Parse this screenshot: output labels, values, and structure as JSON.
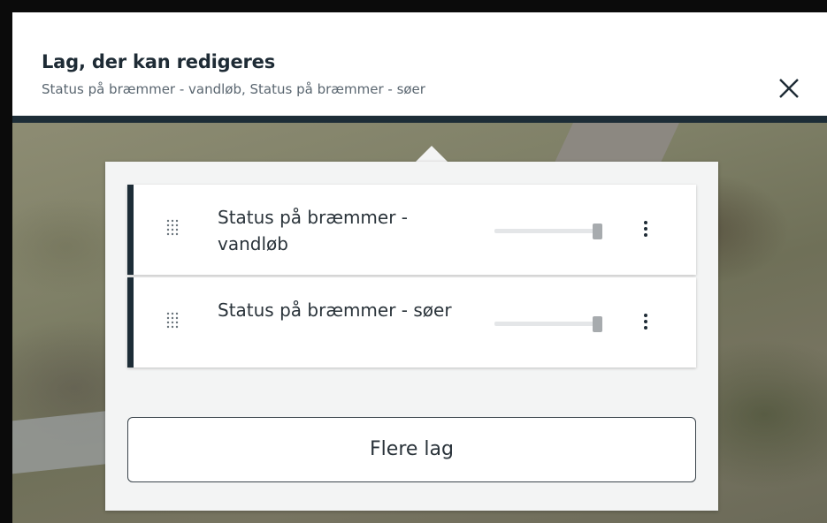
{
  "header": {
    "title": "Lag, der kan redigeres",
    "subtitle": "Status på bræmmer - vandløb, Status på bræmmer - søer",
    "close_icon": "close-icon"
  },
  "layers": [
    {
      "label": "Status på bræmmer - vandløb",
      "opacity": 1.0,
      "drag_icon": "drag-handle-icon",
      "menu_icon": "kebab-menu-icon"
    },
    {
      "label": "Status på bræmmer - søer",
      "opacity": 1.0,
      "drag_icon": "drag-handle-icon",
      "menu_icon": "kebab-menu-icon"
    }
  ],
  "footer": {
    "more_layers_label": "Flere lag"
  },
  "colors": {
    "accent": "#1d2d37",
    "panel_bg": "#f3f4f4",
    "text": "#2a333a",
    "subtitle": "#5a6670"
  }
}
